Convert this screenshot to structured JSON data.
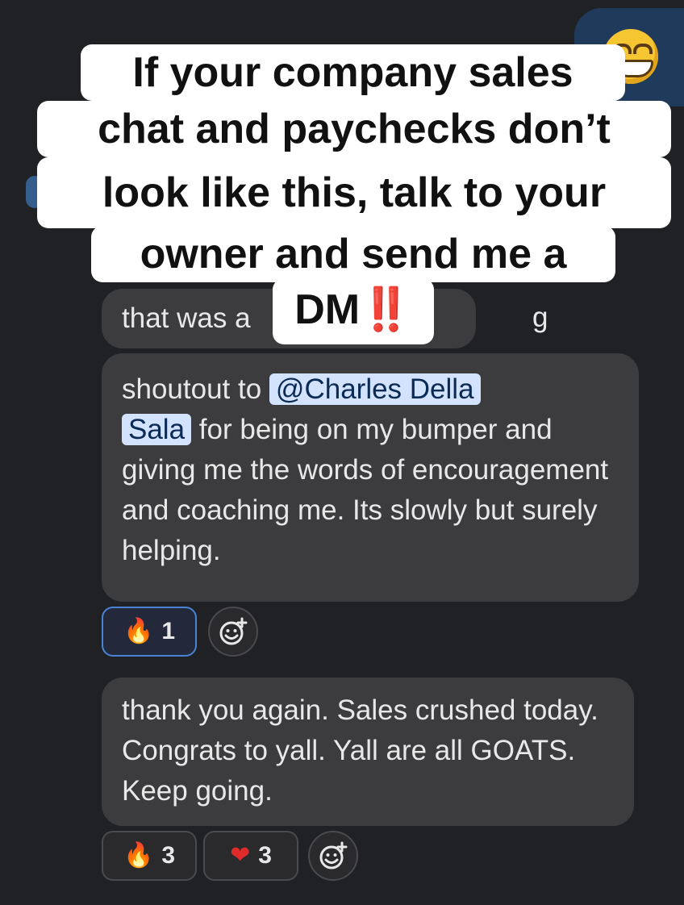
{
  "overlay_caption": {
    "line1": "If your company sales",
    "line2": "chat and paychecks don’t",
    "line3": "look like this, talk to your",
    "line4": "owner and send me a",
    "line5": "DM",
    "line5_emoji": "‼️"
  },
  "messages": [
    {
      "visible_start": "that was a",
      "visible_end": "g"
    },
    {
      "prefix": "shoutout to ",
      "mention_part1": "@Charles Della",
      "mention_part2": "Sala",
      "text": " for being on my bumper and giving me the words of encouragement and coaching me. Its slowly but surely helping.",
      "reactions": [
        {
          "icon": "fire-icon",
          "emoji": "🔥",
          "count": "1",
          "active": true
        }
      ]
    },
    {
      "text": "thank you again. Sales crushed today. Congrats to yall. Yall are all GOATS. Keep going.",
      "reactions": [
        {
          "icon": "fire-icon",
          "emoji": "🔥",
          "count": "3"
        },
        {
          "icon": "heart-icon",
          "emoji": "❤",
          "count": "3"
        }
      ]
    }
  ],
  "colors": {
    "background": "#202124",
    "bubble": "#3c3c3e",
    "mention_bg": "#d3e3fd",
    "active_reaction_border": "#4a82d6",
    "caption_bg": "#ffffff"
  }
}
